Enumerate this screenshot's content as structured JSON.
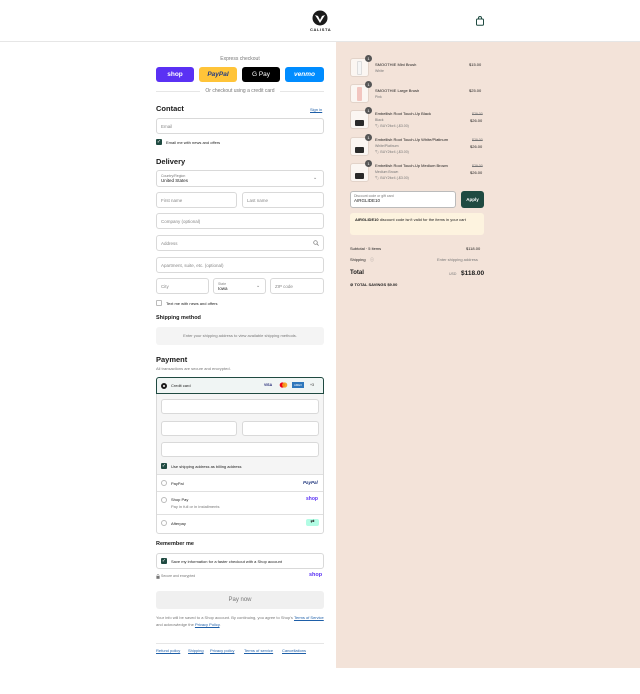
{
  "header": {
    "brand": "CALISTA",
    "cart_icon": "shopping-bag-icon"
  },
  "express": {
    "title": "Express checkout",
    "buttons": [
      "shop",
      "PayPal",
      "G Pay",
      "venmo"
    ],
    "divider": "Or checkout using a credit card"
  },
  "contact": {
    "title": "Contact",
    "sign_in": "Sign in",
    "email_placeholder": "Email",
    "news_label": "Email me with news and offers"
  },
  "delivery": {
    "title": "Delivery",
    "country_label": "Country/Region",
    "country_value": "United States",
    "first_name": "First name",
    "last_name": "Last name",
    "company": "Company (optional)",
    "address": "Address",
    "apartment": "Apartment, suite, etc. (optional)",
    "city": "City",
    "state_label": "State",
    "state_value": "Iowa",
    "zip": "ZIP code",
    "text_me": "Text me with news and offers"
  },
  "shipping": {
    "title": "Shipping method",
    "notice": "Enter your shipping address to view available shipping methods."
  },
  "payment": {
    "title": "Payment",
    "subtitle": "All transactions are secure and encrypted.",
    "credit_card": "Credit card",
    "card_brands": [
      "VISA",
      "MC",
      "AMEX",
      "+3"
    ],
    "billing_same": "Use shipping address as billing address",
    "paypal": "PayPal",
    "paypal_logo": "PayPal",
    "shop_pay": "Shop Pay",
    "shop_pay_sub": "Pay in full or in installments",
    "shop_pay_logo": "shop",
    "afterpay": "Afterpay"
  },
  "remember": {
    "title": "Remember me",
    "save_label": "Save my information for a faster checkout with a Shop account",
    "secure": "Secure and encrypted",
    "shop_logo": "shop"
  },
  "pay_now": "Pay now",
  "legal": {
    "text1": "Your info will be saved to a Shop account. By continuing, you agree to Shop's",
    "tos": "Terms of Service",
    "and": "and acknowledge the",
    "privacy": "Privacy Policy"
  },
  "footer_links": [
    "Refund policy",
    "Shipping",
    "Privacy policy",
    "Terms of service",
    "Cancellations"
  ],
  "cart": {
    "items": [
      {
        "qty": "1",
        "name": "SMOOTHIE Mini Brush",
        "variant": "White",
        "price": "$15.00",
        "original": "",
        "discount": ""
      },
      {
        "qty": "1",
        "name": "SMOOTHIE Large Brush",
        "variant": "Pink",
        "price": "$25.00",
        "original": "",
        "discount": ""
      },
      {
        "qty": "1",
        "name": "Embellish Root Touch-Up Black",
        "variant": "Black",
        "price": "$26.00",
        "original": "$29.00",
        "discount": "BUY2for4 (-$3.00)"
      },
      {
        "qty": "1",
        "name": "Embellish Root Touch-Up White/Platinum",
        "variant": "White/Platinum",
        "price": "$26.00",
        "original": "$29.00",
        "discount": "BUY2for4 (-$3.00)"
      },
      {
        "qty": "1",
        "name": "Embellish Root Touch-Up Medium Brown",
        "variant": "Medium Brown",
        "price": "$26.00",
        "original": "$29.00",
        "discount": "BUY2for4 (-$3.00)"
      }
    ],
    "discount_label": "Discount code or gift card",
    "discount_value": "AIRGLIDE10",
    "apply": "Apply",
    "error_code": "AIRGLIDE10",
    "error_text": "discount code isn't valid for the items in your cart",
    "subtotal_label": "Subtotal · 5 items",
    "subtotal_value": "$118.00",
    "shipping_label": "Shipping",
    "shipping_value": "Enter shipping address",
    "total_label": "Total",
    "currency": "USD",
    "total_value": "$118.00",
    "savings_label": "TOTAL SAVINGS",
    "savings_value": "$9.00"
  }
}
